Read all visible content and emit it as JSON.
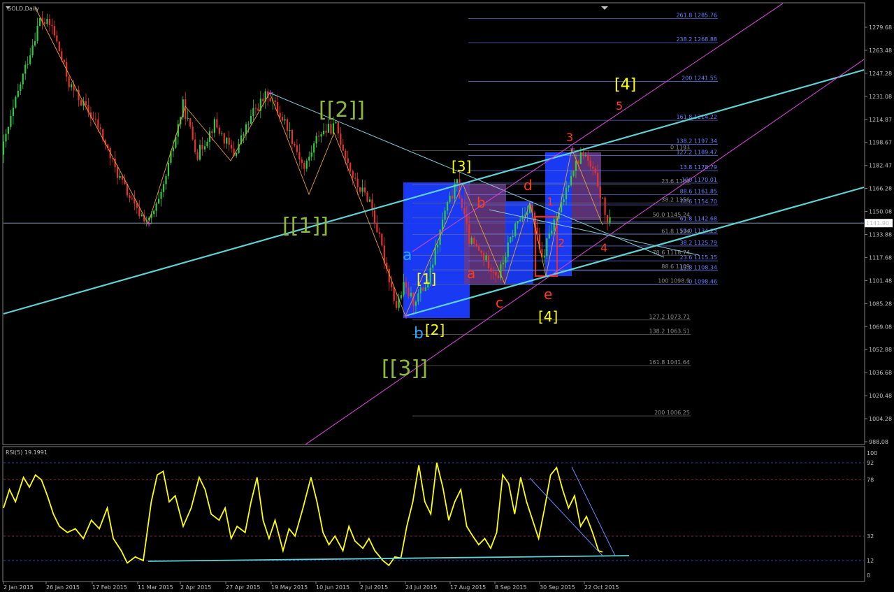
{
  "window": {
    "title": "GOLD,Daily",
    "indicator_title": "RSI(5) 19.1991",
    "current_price_label": "1141.90"
  },
  "colors": {
    "bull": "#2ecc40",
    "bear": "#e8322a",
    "channel": "#5fd3d3",
    "parallel": "#cc44cc",
    "fib": "#6b7fff",
    "fib_text": "#6b7fff",
    "rsi": "#ffff00",
    "zone": "#1a3cff",
    "zone_purple": "#6a3a8a",
    "label_green": "#8fb838",
    "label_yellow": "#ffff00",
    "label_red": "#ff3a1a",
    "label_blue": "#26a6ff"
  },
  "chart_data": [
    {
      "type": "candlestick",
      "title": "GOLD,Daily",
      "ylim": [
        988.08,
        1294
      ],
      "y_ticks": [
        "1279.68",
        "1263.48",
        "1247.28",
        "1231.08",
        "1214.87",
        "1198.67",
        "1182.47",
        "1166.28",
        "1150.08",
        "1133.88",
        "1117.68",
        "1101.48",
        "1085.28",
        "1069.08",
        "1052.88",
        "1036.68",
        "1020.48",
        "1004.28",
        "988.08"
      ],
      "x_tick_labels": [
        "2 Jan 2015",
        "26 Jan 2015",
        "17 Feb 2015",
        "11 Mar 2015",
        "2 Apr 2015",
        "27 Apr 2015",
        "19 May 2015",
        "10 Jun 2015",
        "2 Jul 2015",
        "24 Jul 2015",
        "17 Aug 2015",
        "8 Sep 2015",
        "30 Sep 2015",
        "22 Oct 2015"
      ],
      "current_price": 1141.9,
      "price_path": [
        [
          0,
          1190
        ],
        [
          8,
          1240
        ],
        [
          16,
          1285
        ],
        [
          21,
          1280
        ],
        [
          28,
          1240
        ],
        [
          40,
          1210
        ],
        [
          47,
          1180
        ],
        [
          56,
          1150
        ],
        [
          61,
          1143
        ],
        [
          66,
          1160
        ],
        [
          75,
          1225
        ],
        [
          81,
          1190
        ],
        [
          88,
          1212
        ],
        [
          96,
          1190
        ],
        [
          104,
          1220
        ],
        [
          110,
          1233
        ],
        [
          118,
          1210
        ],
        [
          125,
          1180
        ],
        [
          131,
          1205
        ],
        [
          138,
          1210
        ],
        [
          146,
          1170
        ],
        [
          152,
          1158
        ],
        [
          159,
          1110
        ],
        [
          163,
          1083
        ],
        [
          166,
          1097
        ],
        [
          170,
          1087
        ],
        [
          176,
          1100
        ],
        [
          183,
          1150
        ],
        [
          188,
          1170
        ],
        [
          193,
          1130
        ],
        [
          198,
          1120
        ],
        [
          205,
          1105
        ],
        [
          212,
          1140
        ],
        [
          218,
          1155
        ],
        [
          223,
          1115
        ],
        [
          226,
          1135
        ],
        [
          230,
          1148
        ],
        [
          235,
          1178
        ],
        [
          240,
          1192
        ],
        [
          246,
          1170
        ],
        [
          250,
          1142
        ]
      ],
      "fib_levels": [
        {
          "label": "261.8 1285.76",
          "value": 1285.76
        },
        {
          "label": "238.2 1268.88",
          "value": 1268.88
        },
        {
          "label": "200 1241.55",
          "value": 1241.55
        },
        {
          "label": "161.8 1214.22",
          "value": 1214.22
        },
        {
          "label": "138.2 1197.34",
          "value": 1197.34
        },
        {
          "label": "127.2 1189.47",
          "value": 1189.47
        },
        {
          "label": "13.8 1178.79",
          "value": 1178.79
        },
        {
          "label": "100 1170.01",
          "value": 1170.01
        },
        {
          "label": "88.6 1161.85",
          "value": 1161.85
        },
        {
          "label": "78.6 1154.70",
          "value": 1154.7
        },
        {
          "label": "61.8 1142.68",
          "value": 1142.68
        },
        {
          "label": "50.0 1134.23",
          "value": 1134.23
        },
        {
          "label": "38.2 1125.79",
          "value": 1125.79
        },
        {
          "label": "23.6 1115.35",
          "value": 1115.35
        },
        {
          "label": "13.8 1108.34",
          "value": 1108.34
        },
        {
          "label": "0 1098.46",
          "value": 1098.46
        }
      ],
      "fib_levels_secondary": [
        {
          "label": "0 1193",
          "value": 1193
        },
        {
          "label": "23.6 1169",
          "value": 1169
        },
        {
          "label": "38.2 1156",
          "value": 1156
        },
        {
          "label": "50.0 1145.24",
          "value": 1145.5
        },
        {
          "label": "61.8 1134",
          "value": 1134
        },
        {
          "label": "78.6 1118.74",
          "value": 1119
        },
        {
          "label": "88.6 1109",
          "value": 1109
        },
        {
          "label": "100 1098.9",
          "value": 1098.9
        },
        {
          "label": "127.2 1073.71",
          "value": 1073.71
        },
        {
          "label": "138.2 1063.51",
          "value": 1063.51
        },
        {
          "label": "161.8 1041.64",
          "value": 1041.64
        },
        {
          "label": "200 1006.25",
          "value": 1006.25
        }
      ],
      "wave_labels": [
        {
          "text": "[[1]]",
          "color": "green"
        },
        {
          "text": "[[2]]",
          "color": "green"
        },
        {
          "text": "[[3]]",
          "color": "green"
        },
        {
          "text": "[1]",
          "color": "yellow"
        },
        {
          "text": "[2]",
          "color": "yellow"
        },
        {
          "text": "[3]",
          "color": "yellow"
        },
        {
          "text": "[4]",
          "color": "yellow"
        },
        {
          "text": "[4]",
          "color": "yellow"
        },
        {
          "text": "a",
          "color": "blue"
        },
        {
          "text": "b",
          "color": "blue"
        },
        {
          "text": "a",
          "color": "red"
        },
        {
          "text": "b",
          "color": "red"
        },
        {
          "text": "c",
          "color": "red"
        },
        {
          "text": "d",
          "color": "red"
        },
        {
          "text": "e",
          "color": "red"
        },
        {
          "text": "1",
          "color": "red"
        },
        {
          "text": "2",
          "color": "red"
        },
        {
          "text": "3",
          "color": "red"
        },
        {
          "text": "4",
          "color": "red"
        },
        {
          "text": "5",
          "color": "red"
        }
      ]
    },
    {
      "type": "line",
      "title": "RSI(5) 19.1991",
      "ylim": [
        0,
        100
      ],
      "y_ticks": [
        "100",
        "92",
        "78",
        "32",
        "12",
        "0"
      ],
      "levels": [
        92,
        78,
        32,
        12
      ],
      "series": [
        {
          "name": "RSI(5) 19.1991",
          "values": [
            [
              0,
              55
            ],
            [
              3,
              70
            ],
            [
              6,
              60
            ],
            [
              10,
              80
            ],
            [
              13,
              72
            ],
            [
              16,
              82
            ],
            [
              19,
              78
            ],
            [
              22,
              65
            ],
            [
              25,
              50
            ],
            [
              28,
              40
            ],
            [
              32,
              35
            ],
            [
              36,
              38
            ],
            [
              40,
              30
            ],
            [
              44,
              45
            ],
            [
              48,
              38
            ],
            [
              52,
              55
            ],
            [
              55,
              30
            ],
            [
              59,
              20
            ],
            [
              62,
              10
            ],
            [
              66,
              15
            ],
            [
              70,
              12
            ],
            [
              74,
              60
            ],
            [
              77,
              82
            ],
            [
              80,
              85
            ],
            [
              83,
              60
            ],
            [
              86,
              65
            ],
            [
              90,
              40
            ],
            [
              94,
              55
            ],
            [
              98,
              80
            ],
            [
              101,
              70
            ],
            [
              104,
              50
            ],
            [
              108,
              45
            ],
            [
              111,
              55
            ],
            [
              114,
              30
            ],
            [
              117,
              40
            ],
            [
              121,
              35
            ],
            [
              124,
              60
            ],
            [
              127,
              80
            ],
            [
              130,
              45
            ],
            [
              133,
              30
            ],
            [
              136,
              45
            ],
            [
              140,
              20
            ],
            [
              143,
              38
            ],
            [
              146,
              32
            ],
            [
              150,
              55
            ],
            [
              154,
              80
            ],
            [
              157,
              60
            ],
            [
              160,
              35
            ],
            [
              163,
              25
            ],
            [
              166,
              32
            ],
            [
              170,
              20
            ],
            [
              173,
              40
            ],
            [
              176,
              28
            ],
            [
              180,
              22
            ],
            [
              183,
              30
            ],
            [
              186,
              20
            ],
            [
              190,
              12
            ],
            [
              193,
              8
            ],
            [
              196,
              15
            ],
            [
              199,
              14
            ],
            [
              202,
              40
            ],
            [
              205,
              60
            ],
            [
              208,
              90
            ],
            [
              211,
              60
            ],
            [
              214,
              50
            ],
            [
              217,
              92
            ],
            [
              220,
              72
            ],
            [
              223,
              45
            ],
            [
              226,
              60
            ],
            [
              229,
              70
            ],
            [
              232,
              40
            ],
            [
              235,
              32
            ],
            [
              238,
              25
            ],
            [
              241,
              30
            ],
            [
              244,
              22
            ],
            [
              247,
              35
            ],
            [
              250,
              82
            ],
            [
              253,
              75
            ],
            [
              256,
              50
            ],
            [
              259,
              80
            ],
            [
              262,
              60
            ],
            [
              265,
              45
            ],
            [
              268,
              30
            ],
            [
              271,
              55
            ],
            [
              274,
              82
            ],
            [
              277,
              88
            ],
            [
              280,
              70
            ],
            [
              283,
              55
            ],
            [
              286,
              65
            ],
            [
              289,
              40
            ],
            [
              292,
              48
            ],
            [
              295,
              35
            ],
            [
              298,
              20
            ],
            [
              300,
              19
            ]
          ]
        }
      ]
    }
  ]
}
